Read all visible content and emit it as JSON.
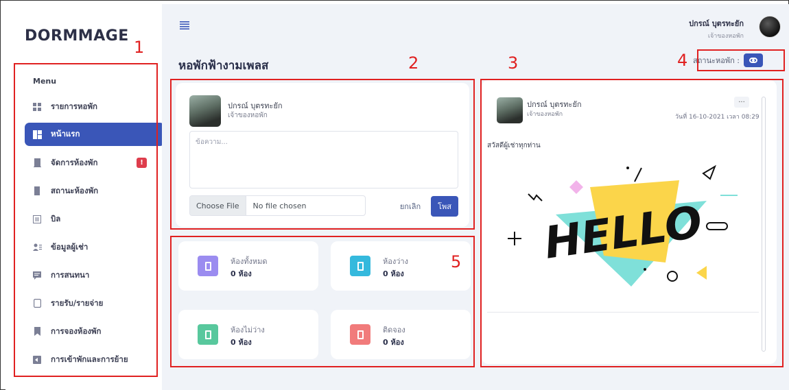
{
  "app": {
    "logo": "DORMMAGE"
  },
  "sidebar": {
    "menu_title": "Menu",
    "items": [
      {
        "label": "รายการหอพัก",
        "icon": "grid-icon",
        "active": false
      },
      {
        "label": "หน้าแรก",
        "icon": "dashboard-icon",
        "active": true
      },
      {
        "label": "จัดการห้องพัก",
        "icon": "building-icon",
        "active": false,
        "badge": "!"
      },
      {
        "label": "สถานะห้องพัก",
        "icon": "door-icon",
        "active": false
      },
      {
        "label": "บิล",
        "icon": "bill-icon",
        "active": false
      },
      {
        "label": "ข้อมูลผู้เช่า",
        "icon": "users-icon",
        "active": false
      },
      {
        "label": "การสนทนา",
        "icon": "chat-icon",
        "active": false
      },
      {
        "label": "รายรับ/รายจ่าย",
        "icon": "money-icon",
        "active": false
      },
      {
        "label": "การจองห้องพัก",
        "icon": "bookmark-icon",
        "active": false
      },
      {
        "label": "การเข้าพักและการย้าย",
        "icon": "move-icon",
        "active": false
      }
    ]
  },
  "header": {
    "user_name": "ปกรณ์ บุตรทะยัก",
    "user_role": "เจ้าของหอพัก",
    "page_title": "หอพักฟ้างามเพลส",
    "status_label": "สถานะหอพัก :"
  },
  "composer": {
    "user_name": "ปกรณ์ บุตรทะยัก",
    "user_role": "เจ้าของหอพัก",
    "placeholder": "ข้อความ...",
    "choose_file": "Choose File",
    "no_file": "No file chosen",
    "cancel": "ยกเลิก",
    "post": "โพส"
  },
  "stats": [
    {
      "label": "ห้องทั้งหมด",
      "value": "0 ห้อง",
      "color": "#9b8cf0"
    },
    {
      "label": "ห้องว่าง",
      "value": "0 ห้อง",
      "color": "#35b9dd"
    },
    {
      "label": "ห้องไม่ว่าง",
      "value": "0 ห้อง",
      "color": "#58c89d"
    },
    {
      "label": "ติดจอง",
      "value": "0 ห้อง",
      "color": "#f17b7b"
    }
  ],
  "feed_post": {
    "user_name": "ปกรณ์ บุตรทะยัก",
    "user_role": "เจ้าของหอพัก",
    "more": "···",
    "date": "วันที่ 16-10-2021 เวลา 08:29",
    "text": "สวัสดีผู้เช่าทุกท่าน",
    "image_text": "HELLO"
  },
  "annotations": [
    "1",
    "2",
    "3",
    "4",
    "5"
  ],
  "colors": {
    "primary": "#3a56b8",
    "annotation": "#e02020",
    "badge": "#de3d4c"
  }
}
